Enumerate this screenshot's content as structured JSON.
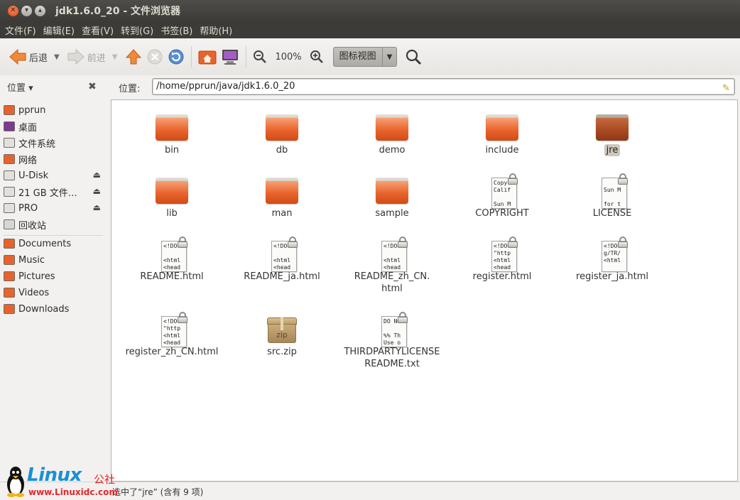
{
  "window": {
    "title": "jdk1.6.0_20 - 文件浏览器"
  },
  "menubar": [
    "文件(F)",
    "编辑(E)",
    "查看(V)",
    "转到(G)",
    "书签(B)",
    "帮助(H)"
  ],
  "toolbar": {
    "back_label": "后退",
    "forward_label": "前进",
    "zoom_level": "100%",
    "view_mode": "图标视图"
  },
  "sidebar": {
    "header_label": "位置 ▾",
    "places": [
      {
        "label": "pprun",
        "icon": "home-folder-icon"
      },
      {
        "label": "桌面",
        "icon": "desktop-icon"
      },
      {
        "label": "文件系统",
        "icon": "drive-icon"
      },
      {
        "label": "网络",
        "icon": "network-icon"
      },
      {
        "label": "U-Disk",
        "icon": "usb-drive-icon",
        "eject": true
      },
      {
        "label": "21 GB 文件…",
        "icon": "drive-icon",
        "eject": true
      },
      {
        "label": "PRO",
        "icon": "drive-icon",
        "eject": true
      },
      {
        "label": "回收站",
        "icon": "trash-icon"
      }
    ],
    "bookmarks": [
      {
        "label": "Documents",
        "icon": "documents-folder-icon"
      },
      {
        "label": "Music",
        "icon": "music-folder-icon"
      },
      {
        "label": "Pictures",
        "icon": "pictures-folder-icon"
      },
      {
        "label": "Videos",
        "icon": "videos-folder-icon"
      },
      {
        "label": "Downloads",
        "icon": "downloads-folder-icon"
      }
    ]
  },
  "location": {
    "label": "位置:",
    "path": "/home/pprun/java/jdk1.6.0_20"
  },
  "files": [
    {
      "name": "bin",
      "type": "folder"
    },
    {
      "name": "db",
      "type": "folder"
    },
    {
      "name": "demo",
      "type": "folder"
    },
    {
      "name": "include",
      "type": "folder"
    },
    {
      "name": "jre",
      "type": "folder",
      "selected": true
    },
    {
      "name": "lib",
      "type": "folder"
    },
    {
      "name": "man",
      "type": "folder"
    },
    {
      "name": "sample",
      "type": "folder"
    },
    {
      "name": "COPYRIGHT",
      "type": "text",
      "preview": "Copyr\nCalif\n\nSun M"
    },
    {
      "name": "LICENSE",
      "type": "text",
      "preview": "\nSun M\n\nfor t"
    },
    {
      "name": "README.html",
      "type": "html",
      "preview": "<!DOC\n\n<html\n<head"
    },
    {
      "name": "README_ja.html",
      "type": "html",
      "preview": "<!DOC\n\n<html\n<head"
    },
    {
      "name": "README_zh_CN.\nhtml",
      "type": "html",
      "preview": "<!DOC\n\n<html\n<head"
    },
    {
      "name": "register.html",
      "type": "html",
      "preview": "<!DOC\n\"http\n<html\n<head"
    },
    {
      "name": "register_ja.html",
      "type": "html",
      "preview": "<!DOC\ng/TR/\n<html"
    },
    {
      "name": "register_zh_CN.html",
      "type": "html",
      "preview": "<!DOC\n\"http\n<html\n<head"
    },
    {
      "name": "src.zip",
      "type": "zip",
      "badge": "zip"
    },
    {
      "name": "THIRDPARTYLICENSE\nREADME.txt",
      "type": "text",
      "preview": "DO NO\n\n%% Th\nUse o"
    }
  ],
  "status": {
    "text": "选中了“jre” (含有 9 项)"
  },
  "watermark": {
    "brand": "Linux",
    "brand_cn": "公社",
    "url": "www.Linuxidc.com"
  },
  "colors": {
    "accent": "#e8632b",
    "titlebar": "#3c3b37",
    "selection": "#cfc7bb"
  }
}
